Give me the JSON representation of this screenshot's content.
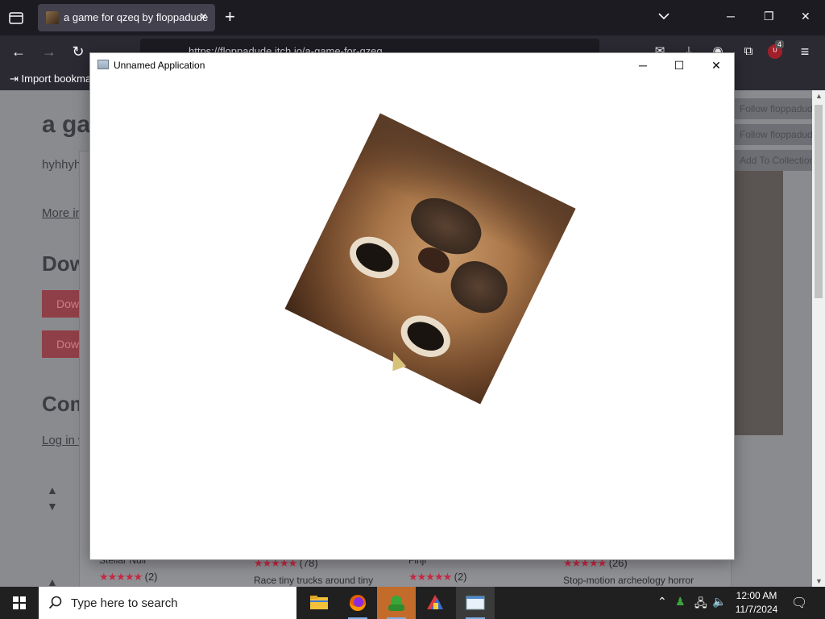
{
  "browser": {
    "tab_title": "a game for qzeq by floppadude",
    "tab_close": "×",
    "new_tab": "+",
    "url": "https://floppadude.itch.io/a-game-for-qzeq",
    "bookmark_import": "Import bookmarks...",
    "extension_badge": "4"
  },
  "page": {
    "title": "a game for qzeq",
    "description": "hyhhyhyhyh",
    "more_info": "More information",
    "download_heading": "Download",
    "download_label": "Download",
    "comments_heading": "Comments",
    "login_text": "Log in with itch.io to leave a comment.",
    "side_buttons": [
      "Follow floppadude",
      "Follow floppadude",
      "Add To Collection"
    ],
    "recs": [
      {
        "name": "Stellar Null",
        "stars": "★★★★★",
        "count": "(2)"
      },
      {
        "name": "",
        "stars": "★★★★★",
        "count": "(78)",
        "desc": "Race tiny trucks around tiny"
      },
      {
        "name": "Finji",
        "stars": "★★★★★",
        "count": "(2)"
      },
      {
        "name": "",
        "stars": "★★★★★",
        "count": "(26)",
        "desc": "Stop-motion archeology horror"
      }
    ]
  },
  "app_window": {
    "title": "Unnamed Application",
    "minimize": "─",
    "maximize": "☐",
    "close": "✕"
  },
  "taskbar": {
    "search_placeholder": "Type here to search",
    "time": "12:00 AM",
    "date": "11/7/2024"
  },
  "colors": {
    "accent_star": "#c62a44",
    "taskbar_bg": "#202020",
    "browser_bg": "#1c1b22"
  }
}
